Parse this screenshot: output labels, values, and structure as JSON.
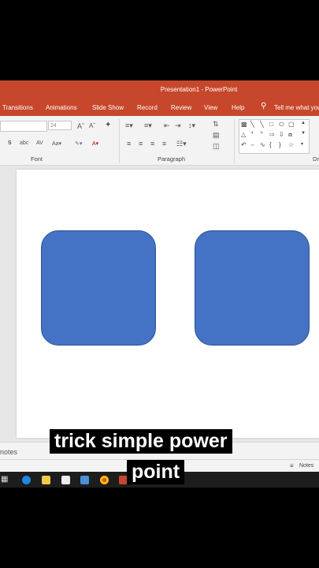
{
  "window": {
    "title": "Presentation1  -  PowerPoint"
  },
  "tabs": [
    "Transitions",
    "Animations",
    "Slide Show",
    "Record",
    "Review",
    "View",
    "Help"
  ],
  "tell_me": {
    "icon": "lightbulb-icon",
    "placeholder": "Tell me what you"
  },
  "ribbon": {
    "font_size": "24",
    "groups": {
      "font": "Font",
      "paragraph": "Paragraph",
      "drawing": "Dr"
    }
  },
  "notes": {
    "left_label": "notes",
    "button": "Notes"
  },
  "caption": {
    "line1": "trick simple power",
    "line2": "point"
  },
  "colors": {
    "accent": "#c6472b",
    "shape_fill": "#4472c4",
    "shape_border": "#2f528f"
  }
}
